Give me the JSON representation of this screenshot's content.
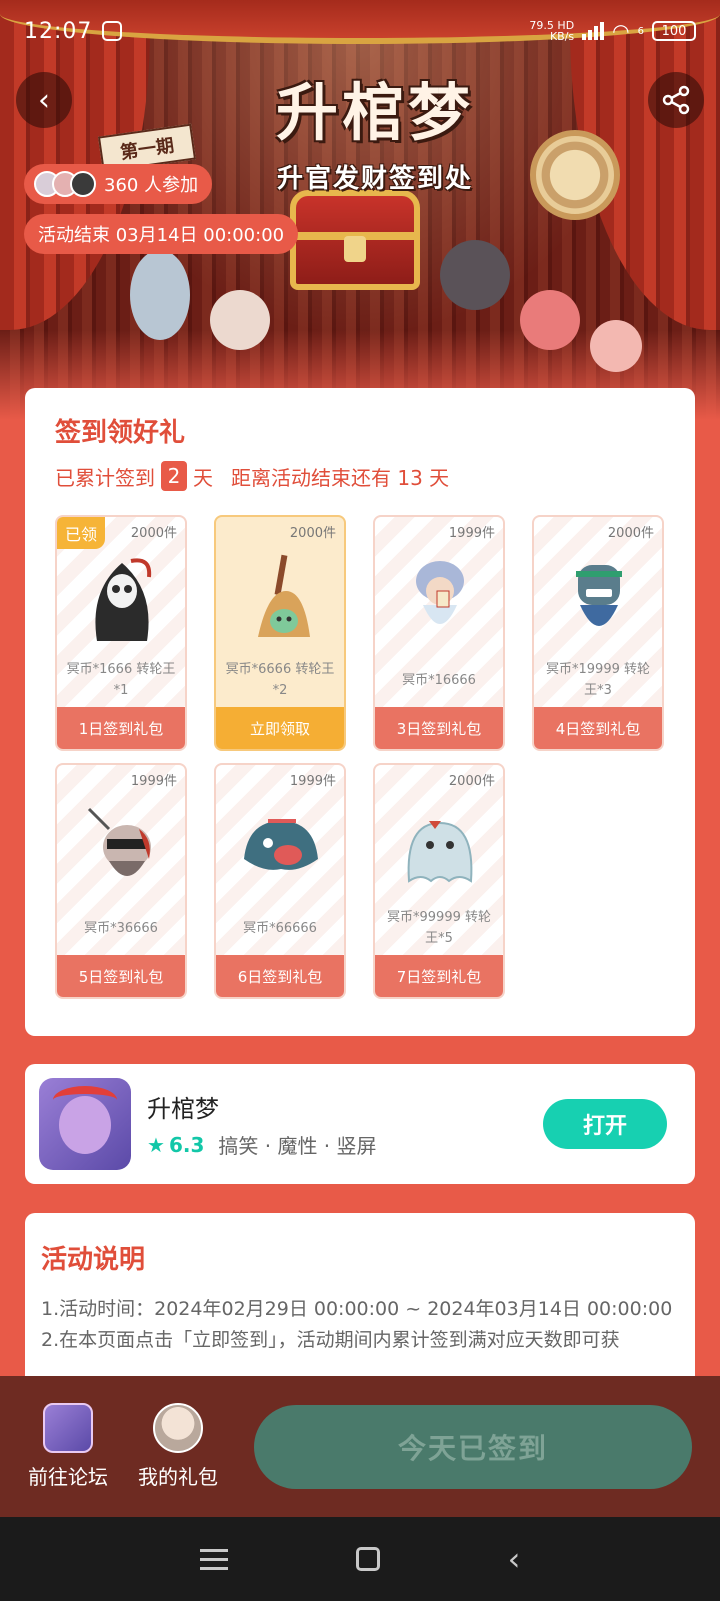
{
  "status_bar": {
    "time": "12:07",
    "net_speed_value": "79.5",
    "net_speed_unit": "KB/s",
    "net_type": "HD",
    "wifi_level": "6",
    "battery": "100"
  },
  "banner": {
    "title": "升棺梦",
    "subtitle": "升官发财签到处",
    "period": "第一期",
    "participants": "360 人参加",
    "end_time": "活动结束 03月14日 00:00:00"
  },
  "signin": {
    "title": "签到领好礼",
    "progress_prefix": "已累计签到",
    "days_signed": "2",
    "progress_unit": "天",
    "remaining_text": "距离活动结束还有 13 天",
    "gifts": [
      {
        "count": "2000件",
        "name": "冥币*1666 转轮王*1",
        "button": "1日签到礼包",
        "badge": "已领"
      },
      {
        "count": "2000件",
        "name": "冥币*6666 转轮王*2",
        "button": "立即领取",
        "badge": ""
      },
      {
        "count": "1999件",
        "name": "冥币*16666",
        "button": "3日签到礼包",
        "badge": ""
      },
      {
        "count": "2000件",
        "name": "冥币*19999 转轮王*3",
        "button": "4日签到礼包",
        "badge": ""
      },
      {
        "count": "1999件",
        "name": "冥币*36666",
        "button": "5日签到礼包",
        "badge": ""
      },
      {
        "count": "1999件",
        "name": "冥币*66666",
        "button": "6日签到礼包",
        "badge": ""
      },
      {
        "count": "2000件",
        "name": "冥币*99999 转轮王*5",
        "button": "7日签到礼包",
        "badge": ""
      }
    ]
  },
  "app": {
    "name": "升棺梦",
    "rating": "6.3",
    "tags": "搞笑 · 魔性 · 竖屏",
    "open_label": "打开"
  },
  "rules": {
    "title": "活动说明",
    "line1": "1.活动时间：2024年02月29日 00:00:00 ~ 2024年03月14日 00:00:00",
    "line2": "2.在本页面点击「立即签到」，活动期间内累计签到满对应天数即可获"
  },
  "bottom_bar": {
    "forum_label": "前往论坛",
    "gifts_label": "我的礼包",
    "checked_label": "今天已签到"
  },
  "colors": {
    "brand_red": "#e85a48",
    "claim_orange": "#f5ae34",
    "open_teal": "#17d0b1",
    "checked_green": "#4a7a6b"
  }
}
